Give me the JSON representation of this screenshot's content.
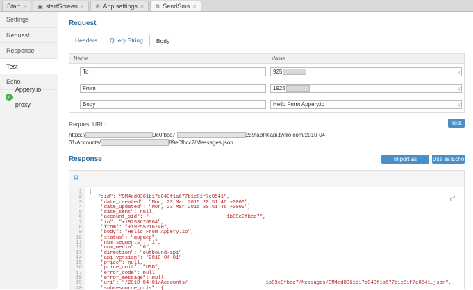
{
  "tabs": [
    {
      "label": "Start",
      "icon": "",
      "active": false
    },
    {
      "label": "startScreen",
      "icon": "screen-icon",
      "active": false
    },
    {
      "label": "App settings",
      "icon": "settings-icon",
      "active": false
    },
    {
      "label": "SendSms",
      "icon": "gear-icon",
      "active": true
    }
  ],
  "sidebar": {
    "items": [
      "Settings",
      "Request",
      "Response",
      "Test",
      "Echo"
    ],
    "proxy_label": "Appery.io proxy"
  },
  "request": {
    "title": "Request",
    "tabs": [
      "Headers",
      "Query String",
      "Body"
    ],
    "col_name": "Name",
    "col_value": "Value",
    "rows": [
      {
        "name": "To",
        "value": "925"
      },
      {
        "name": "From",
        "value": "1925"
      },
      {
        "name": "Body",
        "value": "Hello From Appery.io"
      }
    ]
  },
  "url": {
    "label": "Request URL:",
    "part1": "https://",
    "part2": "9e0fbcc7:",
    "part3": "259fabf@api.twilio.com/2010-04-",
    "part4": "01/Accounts/",
    "part5": "89e0fbcc7/Messages.json"
  },
  "buttons": {
    "test": "Test",
    "import_response": "Import as Response",
    "use_as_echo": "Use as Echo"
  },
  "response": {
    "title": "Response",
    "lines": [
      {
        "n": "1",
        "t": "{"
      },
      {
        "n": "2",
        "t": "   \"sid\": \"SM4ed8361b17d040f1a677b1c81f7e8541\","
      },
      {
        "n": "3",
        "t": "    \"date_created\": \"Mon, 23 Mar 2015 20:51:46 +0000\","
      },
      {
        "n": "4",
        "t": "    \"date_updated\": \"Mon, 23 Mar 2015 20:51:46 +0000\","
      },
      {
        "n": "5",
        "t": "    \"date_sent\": null,"
      },
      {
        "n": "6",
        "t": "    \"account_sid\": \"                          1b89e0fbcc7\","
      },
      {
        "n": "7",
        "t": "    \"to\": \"+19253676864\","
      },
      {
        "n": "8",
        "t": "    \"from\": \"+19255216740\","
      },
      {
        "n": "9",
        "t": "    \"body\": \"Hello From Appery.io\","
      },
      {
        "n": "10",
        "t": "    \"status\": \"queued\","
      },
      {
        "n": "11",
        "t": "    \"num_segments\": \"1\","
      },
      {
        "n": "12",
        "t": "    \"num_media\": \"0\","
      },
      {
        "n": "13",
        "t": "    \"direction\": \"outbound-api\","
      },
      {
        "n": "14",
        "t": "    \"api_version\": \"2010-04-01\","
      },
      {
        "n": "15",
        "t": "    \"price\": null,"
      },
      {
        "n": "16",
        "t": "    \"price_unit\": \"USD\","
      },
      {
        "n": "17",
        "t": "    \"error_code\": null,"
      },
      {
        "n": "18",
        "t": "    \"error_message\": null,"
      },
      {
        "n": "19",
        "t": "    \"uri\": \"/2010-04-01/Accounts/                          1b89e0fbcc7/Messages/SM4ed8361b17d040f1a677b1c81f7e8541.json\","
      },
      {
        "n": "20",
        "t": "    \"subresource_uris\": {"
      }
    ]
  },
  "colors": {
    "accent": "#4a8ec7",
    "title": "#2f6b9a",
    "code": "#b22222",
    "success": "#46b34b"
  }
}
